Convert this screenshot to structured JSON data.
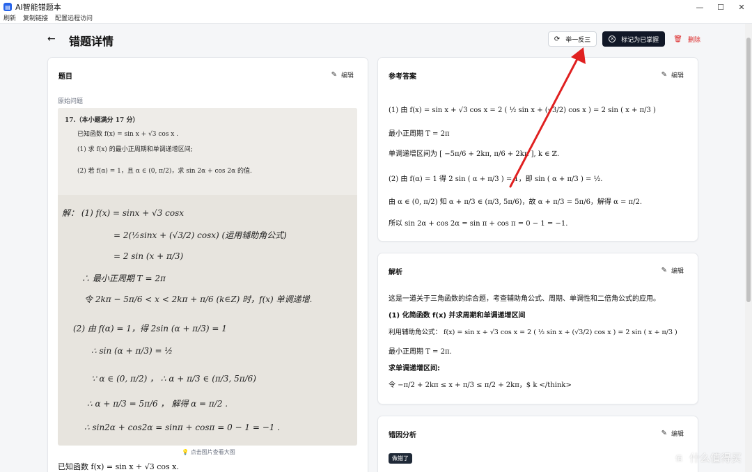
{
  "window": {
    "title": "AI智能错题本",
    "min": "—",
    "max": "☐",
    "close": "✕"
  },
  "menu": [
    "刷新",
    "复制链接",
    "配置远程访问"
  ],
  "header": {
    "back": "←",
    "title": "错题详情",
    "similar_label": "举一反三",
    "mastered_label": "标记为已掌握",
    "delete_label": "删除"
  },
  "question_card": {
    "title": "题目",
    "edit_label": "编辑",
    "original_label": "原始问题",
    "photo": {
      "header": "17.（本小题满分 17 分）",
      "given": "已知函数 f(x) = sin x + √3 cos x .",
      "q1": "(1) 求 f(x) 的最小正周期和单调递增区间;",
      "q2": "(2) 若 f(α) = 1，且 α ∈ (0, π/2)，求 sin 2α + cos 2α 的值.",
      "hw": [
        "解：  (1)   f(x) = sinx + √3 cosx",
        "= 2(½sinx + (√3/2) cosx)        (运用辅助角公式)",
        "= 2 sin (x + π/3)",
        "∴ 最小正周期  T = 2π",
        "令  2kπ − 5π/6 < x < 2kπ + π/6   (k∈Z) 时，f(x) 单调递增.",
        "(2)   由  f(α) = 1，得   2sin (α + π/3) = 1",
        "∴   sin (α + π/3) = ½",
        "∵   α ∈ (0, π/2) ，  ∴  α + π/3 ∈ (π/3, 5π/6)",
        "∴   α + π/3 = 5π/6 ，  解得  α = π/2 .",
        "∴  sin2α + cos2α = sinπ + cosπ = 0 − 1 = −1 ."
      ]
    },
    "photo_hint": "💡 点击图片查看大图",
    "bottom_text": "已知函数 f(x) = sin x + √3 cos x."
  },
  "answer_card": {
    "title": "参考答案",
    "edit_label": "编辑",
    "lines": [
      "(1) 由 f(x) = sin x + √3 cos x = 2 ( ½ sin x + (√3/2) cos x ) = 2 sin ( x + π/3 )",
      "最小正周期 T = 2π",
      "单调递增区间为 [ −5π/6 + 2kπ, π/6 + 2kπ ], k ∈ ℤ.",
      "(2) 由 f(α) = 1 得 2 sin ( α + π/3 ) = 1，即 sin ( α + π/3 ) = ½.",
      "由 α ∈ (0, π/2) 知 α + π/3 ∈ (π/3, 5π/6)，故 α + π/3 = 5π/6，解得 α = π/2.",
      "所以 sin 2α + cos 2α = sin π + cos π = 0 − 1 = −1."
    ]
  },
  "analysis_card": {
    "title": "解析",
    "edit_label": "编辑",
    "lines": [
      "这是一道关于三角函数的综合题，考查辅助角公式、周期、单调性和二倍角公式的应用。",
      "(1) 化简函数 f(x) 并求周期和单调递增区间",
      "利用辅助角公式：  f(x) = sin x + √3 cos x = 2 ( ½ sin x + (√3/2) cos x ) = 2 sin ( x + π/3 )",
      "最小正周期 T = 2π.",
      "求单调递增区间:",
      "令 −π/2 + 2kπ ≤ x + π/3 ≤ π/2 + 2kπ，$ k </think>"
    ]
  },
  "error_card": {
    "title": "错因分析",
    "edit_label": "编辑",
    "tag": "做错了"
  },
  "watermark": {
    "text": "什么值得买",
    "logo": "值"
  },
  "colors": {
    "accent": "#111827",
    "danger": "#dc2626",
    "arrow": "#e02020"
  }
}
